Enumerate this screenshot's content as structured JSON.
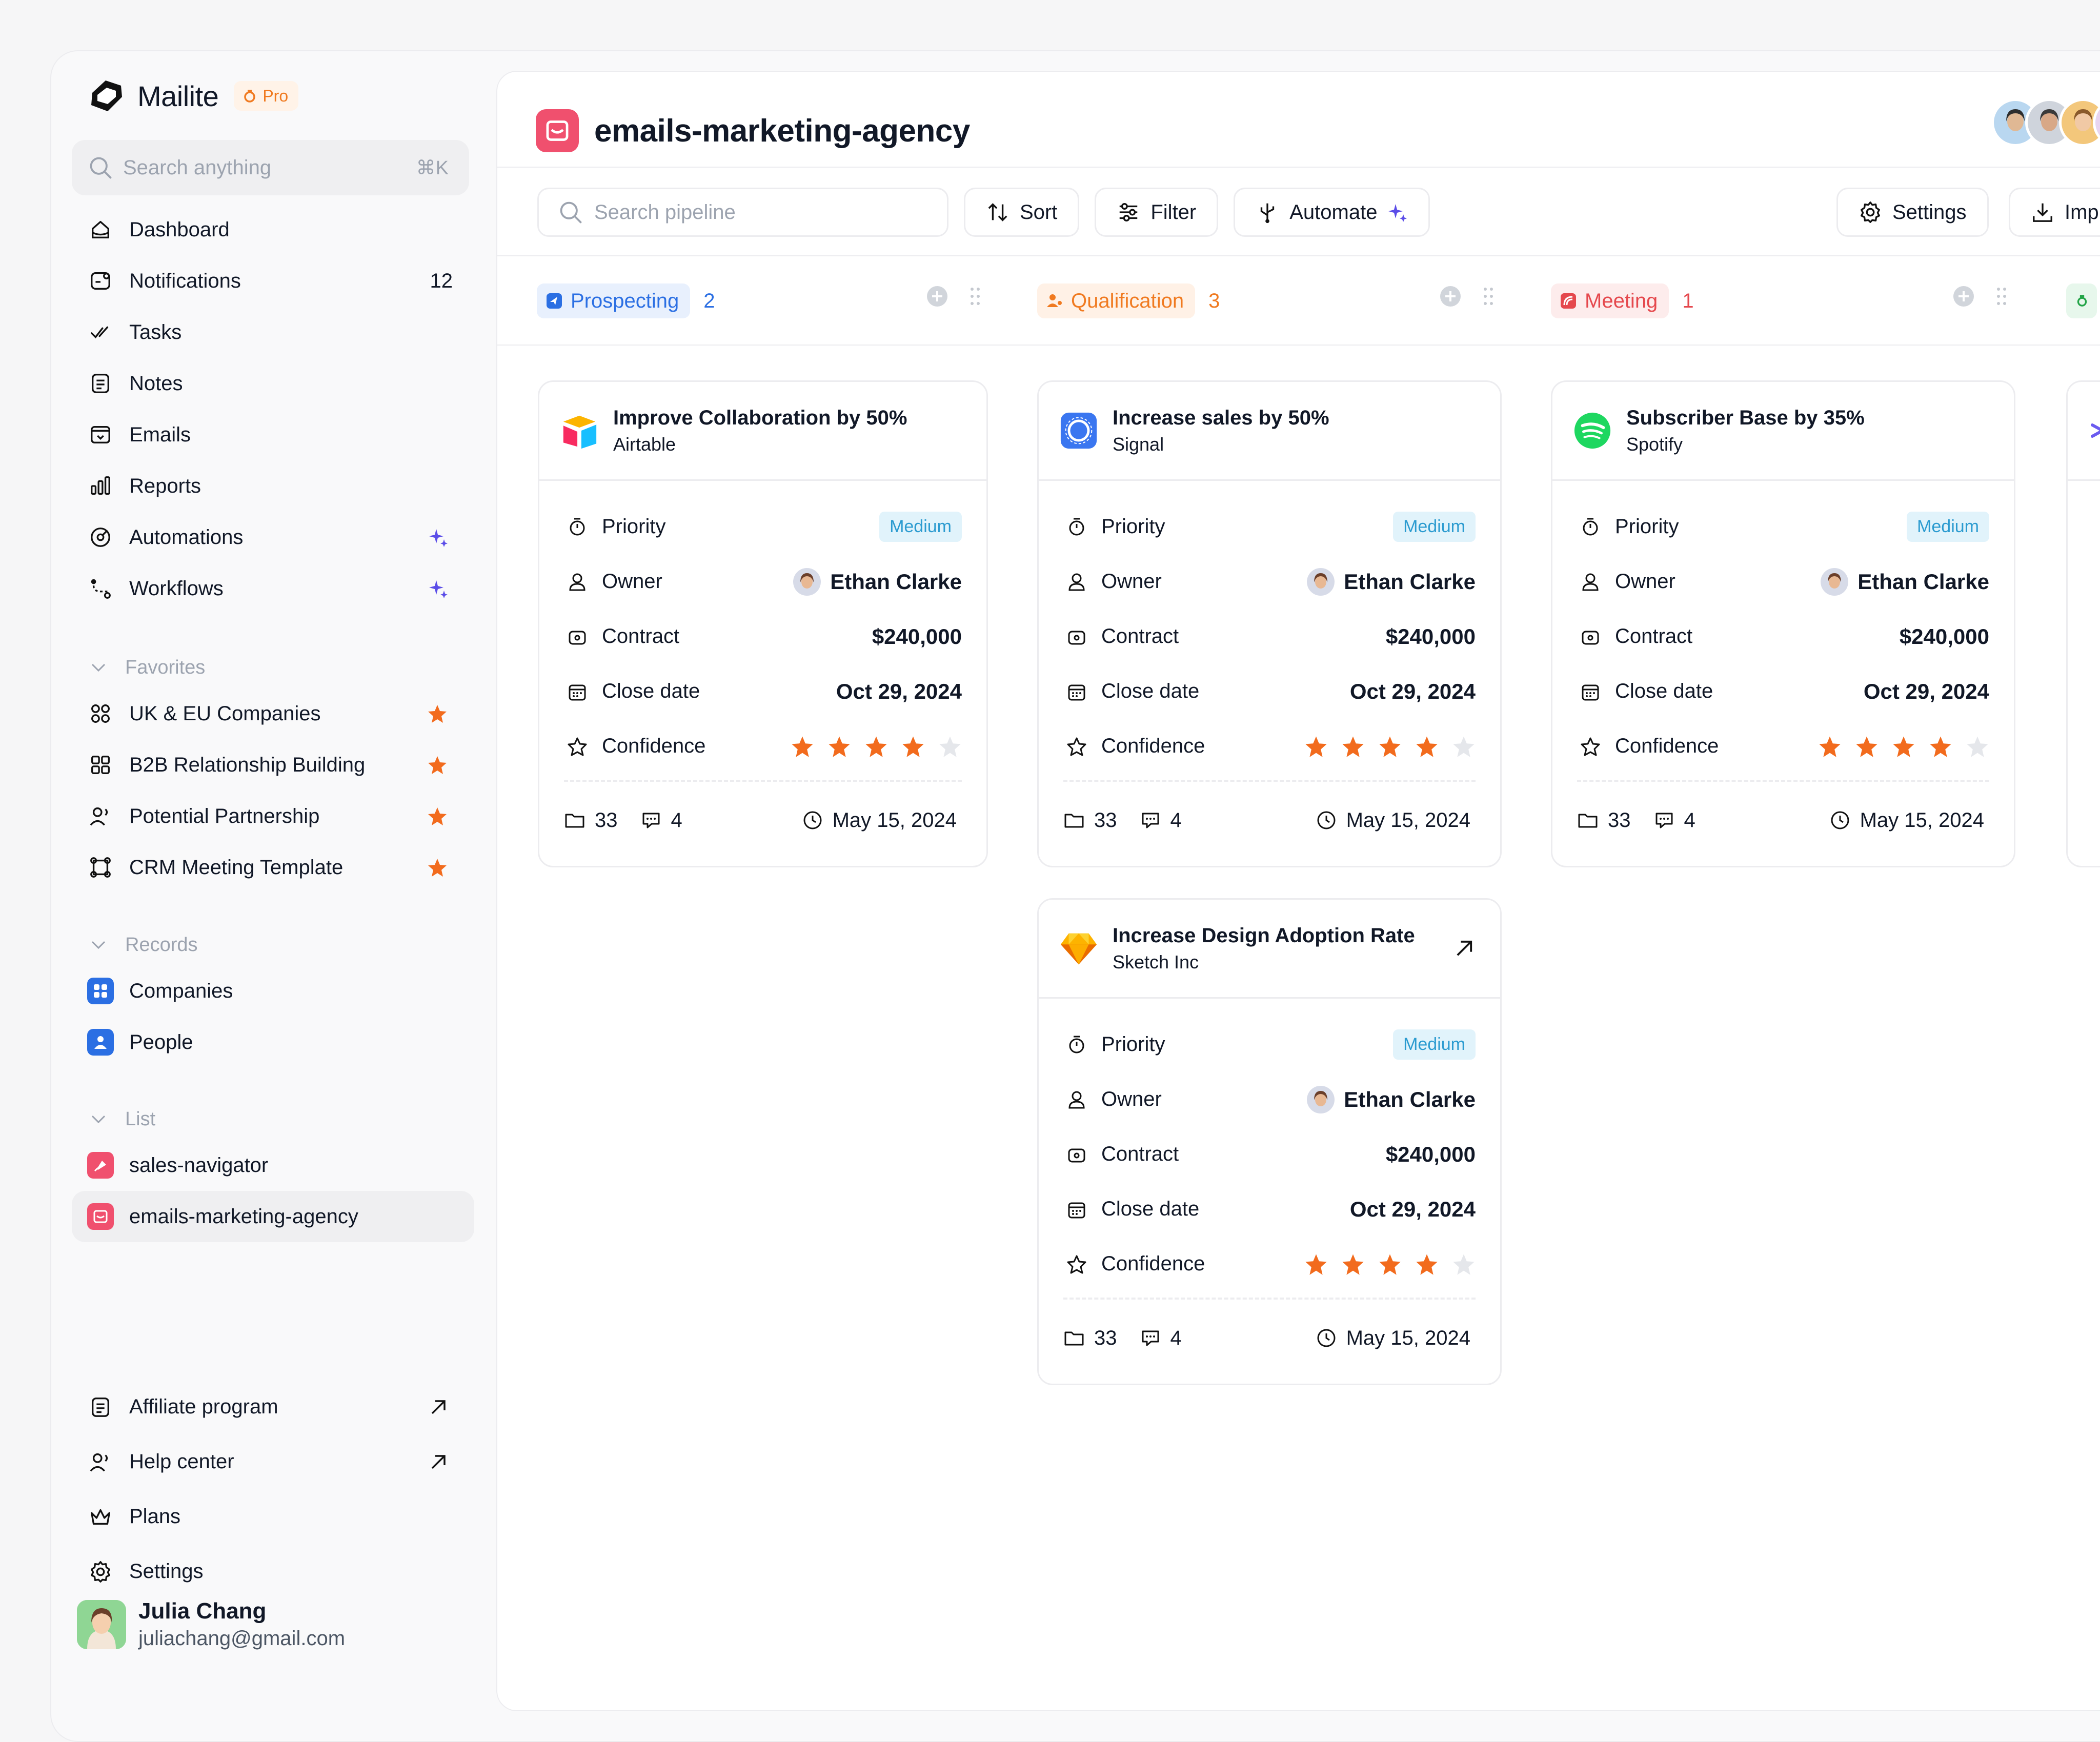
{
  "app": {
    "name": "Mailite",
    "badge": "Pro"
  },
  "sidebar": {
    "search_placeholder": "Search anything",
    "search_shortcut": "⌘K",
    "nav": [
      {
        "label": "Dashboard",
        "icon": "home-icon"
      },
      {
        "label": "Notifications",
        "icon": "bell-icon",
        "count": "12"
      },
      {
        "label": "Tasks",
        "icon": "check-icon"
      },
      {
        "label": "Notes",
        "icon": "note-icon"
      },
      {
        "label": "Emails",
        "icon": "inbox-icon"
      },
      {
        "label": "Reports",
        "icon": "chart-icon"
      },
      {
        "label": "Automations",
        "icon": "automation-icon"
      },
      {
        "label": "Workflows",
        "icon": "workflow-icon"
      }
    ],
    "favorites_title": "Favorites",
    "favorites": [
      {
        "label": "UK & EU Companies"
      },
      {
        "label": "B2B Relationship Building"
      },
      {
        "label": "Potential Partnership"
      },
      {
        "label": "CRM Meeting Template"
      }
    ],
    "records_title": "Records",
    "records": [
      {
        "label": "Companies"
      },
      {
        "label": "People"
      }
    ],
    "list_title": "List",
    "lists": [
      {
        "label": "sales-navigator"
      },
      {
        "label": "emails-marketing-agency"
      }
    ],
    "bottom": [
      {
        "label": "Affiliate program"
      },
      {
        "label": "Help center"
      },
      {
        "label": "Plans"
      },
      {
        "label": "Settings"
      }
    ],
    "user": {
      "name": "Julia Chang",
      "email": "juliachang@gmail.com"
    }
  },
  "main": {
    "title": "emails-marketing-agency",
    "toolbar": {
      "search_placeholder": "Search pipeline",
      "sort": "Sort",
      "filter": "Filter",
      "automate": "Automate",
      "settings": "Settings",
      "import": "Imp"
    },
    "columns": [
      {
        "name": "Prospecting",
        "count": "2",
        "color": "#2b6fe3",
        "bg": "#e8f0fd"
      },
      {
        "name": "Qualification",
        "count": "3",
        "color": "#f07a20",
        "bg": "#fff1e6"
      },
      {
        "name": "Meeting",
        "count": "1",
        "color": "#e5484d",
        "bg": "#fdecec"
      }
    ],
    "labels": {
      "priority": "Priority",
      "owner": "Owner",
      "contract": "Contract",
      "close_date": "Close date",
      "confidence": "Confidence"
    },
    "cards": [
      {
        "title": "Improve Collaboration by 50%",
        "company": "Airtable",
        "logo": "airtable-logo",
        "priority": "Medium",
        "owner": "Ethan Clarke",
        "contract": "$240,000",
        "close_date": "Oct 29, 2024",
        "confidence": 4,
        "files": "33",
        "comments": "4",
        "due": "May 15, 2024"
      },
      {
        "title": "Increase sales by 50%",
        "company": "Signal",
        "logo": "signal-logo",
        "priority": "Medium",
        "owner": "Ethan Clarke",
        "contract": "$240,000",
        "close_date": "Oct 29, 2024",
        "confidence": 4,
        "files": "33",
        "comments": "4",
        "due": "May 15, 2024"
      },
      {
        "title": "Subscriber Base by 35%",
        "company": "Spotify",
        "logo": "spotify-logo",
        "priority": "Medium",
        "owner": "Ethan Clarke",
        "contract": "$240,000",
        "close_date": "Oct 29, 2024",
        "confidence": 4,
        "files": "33",
        "comments": "4",
        "due": "May 15, 2024"
      },
      {
        "title": "Increase Design Adoption Rate",
        "company": "Sketch Inc",
        "logo": "sketch-logo",
        "priority": "Medium",
        "owner": "Ethan Clarke",
        "contract": "$240,000",
        "close_date": "Oct 29, 2024",
        "confidence": 4,
        "files": "33",
        "comments": "4",
        "due": "May 15, 2024"
      }
    ]
  },
  "colors": {
    "star_on": "#f26b1d",
    "star_off": "#e5e7eb",
    "accent_purple": "#5b4de8"
  }
}
